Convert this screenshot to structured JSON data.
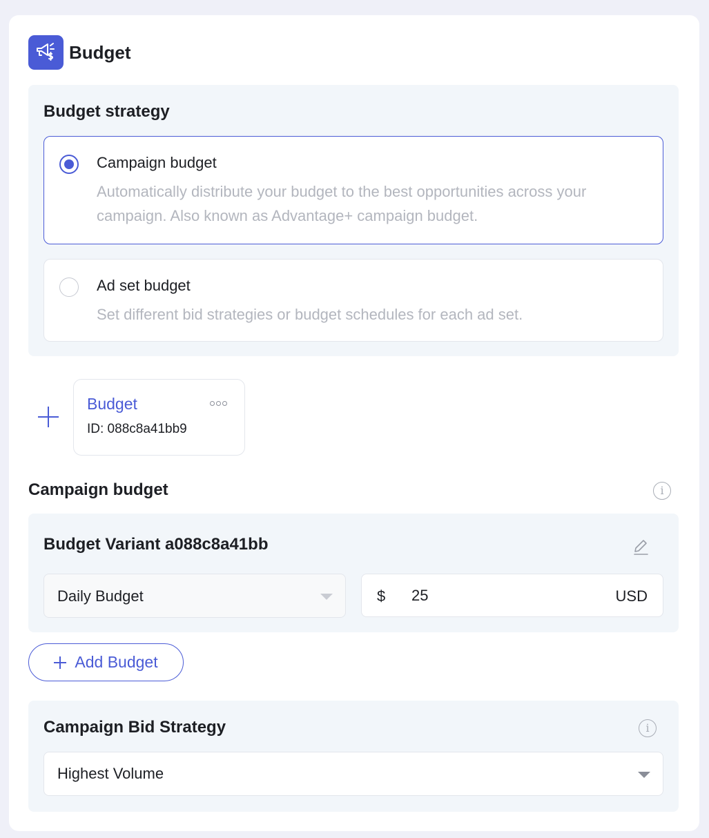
{
  "header": {
    "title": "Budget",
    "icon": "megaphone-dollar-icon"
  },
  "strategy": {
    "title": "Budget strategy",
    "options": [
      {
        "title": "Campaign budget",
        "description": "Automatically distribute your budget to the best opportunities across your campaign. Also known as Advantage+ campaign budget.",
        "selected": true
      },
      {
        "title": "Ad set budget",
        "description": "Set different bid strategies or budget schedules for each ad set.",
        "selected": false
      }
    ]
  },
  "budget_tile": {
    "name": "Budget",
    "id_text": "ID: 088c8a41bb9"
  },
  "campaign_budget": {
    "title": "Campaign budget",
    "variant": {
      "title": "Budget Variant a088c8a41bb",
      "type_value": "Daily Budget",
      "currency_symbol": "$",
      "amount": "25",
      "currency": "USD"
    },
    "add_button_label": "Add Budget"
  },
  "bid_strategy": {
    "title": "Campaign Bid Strategy",
    "value": "Highest Volume"
  },
  "colors": {
    "accent": "#4a5bd6",
    "panel_bg": "#f2f6fa",
    "page_bg": "#eff0f8"
  }
}
